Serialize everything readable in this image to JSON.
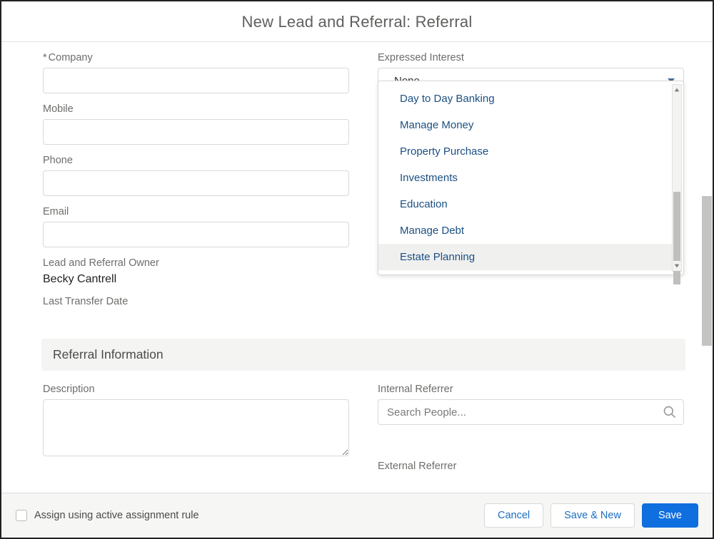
{
  "header": {
    "title": "New Lead and Referral: Referral"
  },
  "left": {
    "company_label": "Company",
    "mobile_label": "Mobile",
    "phone_label": "Phone",
    "email_label": "Email",
    "owner_label": "Lead and Referral Owner",
    "owner_value": "Becky Cantrell",
    "transfer_label": "Last Transfer Date"
  },
  "right": {
    "interest_label": "Expressed Interest",
    "interest_selected": "--None--",
    "interest_options": [
      "Day to Day Banking",
      "Manage Money",
      "Property Purchase",
      "Investments",
      "Education",
      "Manage Debt",
      "Estate Planning"
    ]
  },
  "section": {
    "title": "Referral Information",
    "description_label": "Description",
    "internal_ref_label": "Internal Referrer",
    "internal_ref_placeholder": "Search People...",
    "external_ref_label": "External Referrer"
  },
  "footer": {
    "assign_label": "Assign using active assignment rule",
    "cancel": "Cancel",
    "save_new": "Save & New",
    "save": "Save"
  }
}
